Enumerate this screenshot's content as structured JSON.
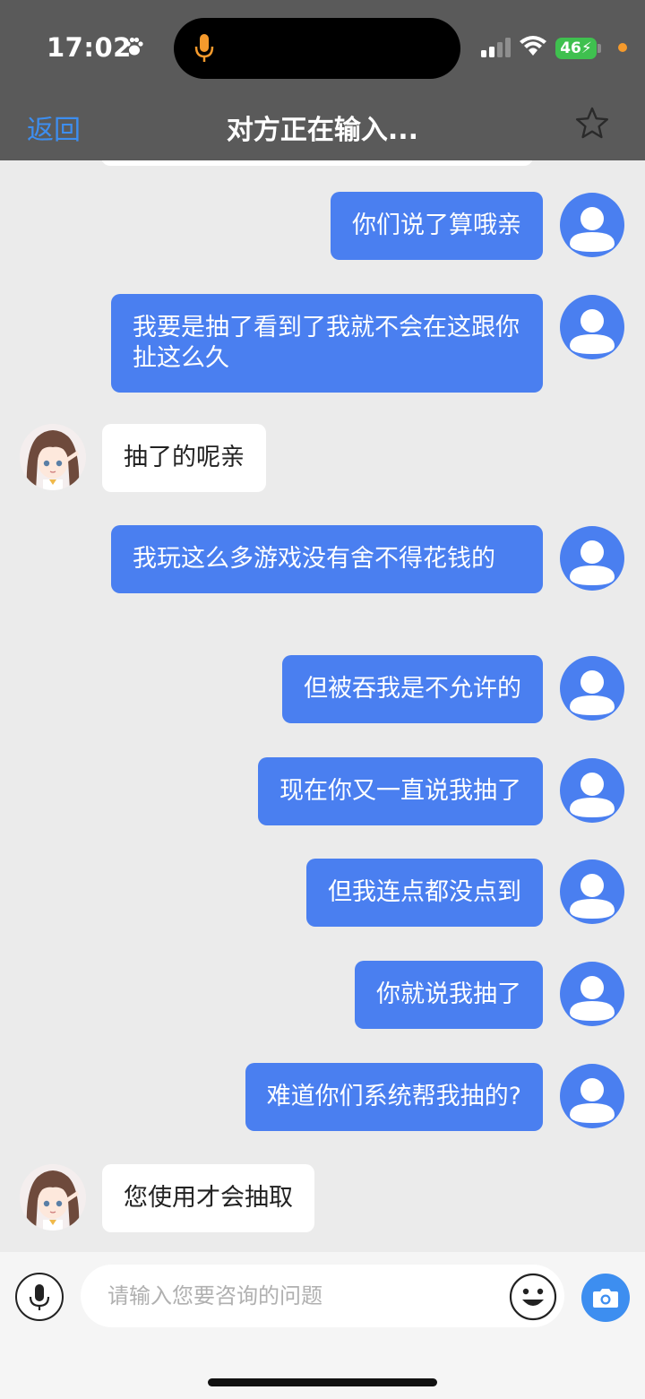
{
  "status_bar": {
    "time": "17:02",
    "battery": "46"
  },
  "header": {
    "back_label": "返回",
    "title": "对方正在输入..."
  },
  "messages": [
    {
      "sender": "me",
      "text": "你们说了算哦亲"
    },
    {
      "sender": "me",
      "text": "我要是抽了看到了我就不会在这跟你扯这么久"
    },
    {
      "sender": "them",
      "text": "抽了的呢亲"
    },
    {
      "sender": "me",
      "text": "我玩这么多游戏没有舍不得花钱的"
    },
    {
      "sender": "me",
      "text": "但被吞我是不允许的"
    },
    {
      "sender": "me",
      "text": "现在你又一直说我抽了"
    },
    {
      "sender": "me",
      "text": "但我连点都没点到"
    },
    {
      "sender": "me",
      "text": "你就说我抽了"
    },
    {
      "sender": "me",
      "text": "难道你们系统帮我抽的?"
    },
    {
      "sender": "them",
      "text": "您使用才会抽取"
    }
  ],
  "input": {
    "placeholder": "请输入您要咨询的问题",
    "value": ""
  },
  "icons": {
    "voice": "microphone-icon",
    "emoji": "smiley-icon",
    "camera": "camera-icon",
    "favorite": "star-outline-icon",
    "user_avatar": "default-user-icon"
  },
  "colors": {
    "accent": "#4a7ff0",
    "link": "#3d8ef0",
    "header_bg": "#5a5a5a",
    "chat_bg": "#ebebeb"
  }
}
